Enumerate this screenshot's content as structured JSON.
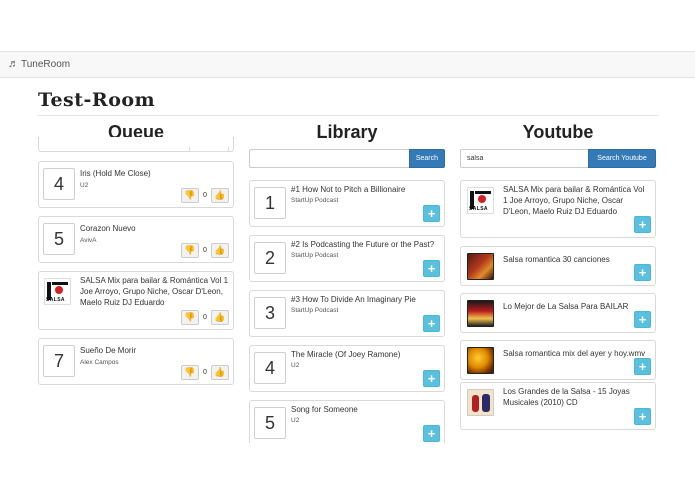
{
  "app": {
    "brand": "TuneRoom"
  },
  "room": {
    "title": "Test-Room"
  },
  "queue": {
    "title": "Queue",
    "items": [
      {
        "number": "4",
        "title": "Iris (Hold Me Close)",
        "artist": "U2",
        "votes": "0"
      },
      {
        "number": "5",
        "title": "Corazon Nuevo",
        "artist": "AvivA",
        "votes": "0"
      },
      {
        "title": "SALSA Mix para bailar & Romántica Vol 1 Joe Arroyo, Grupo Niche, Oscar D'Leon, Maelo Ruiz DJ Eduardo",
        "votes": "0"
      },
      {
        "number": "7",
        "title": "Sueño De Morir",
        "artist": "Alex Campos",
        "votes": "0"
      }
    ]
  },
  "library": {
    "title": "Library",
    "search": {
      "value": "",
      "button": "Search"
    },
    "items": [
      {
        "number": "1",
        "title": "#1 How Not to Pitch a Billionaire",
        "artist": "StartUp Podcast"
      },
      {
        "number": "2",
        "title": "#2 Is Podcasting the Future or the Past?",
        "artist": "StartUp Podcast"
      },
      {
        "number": "3",
        "title": "#3 How To Divide An Imaginary Pie",
        "artist": "StartUp Podcast"
      },
      {
        "number": "4",
        "title": "The Miracle (Of Joey Ramone)",
        "artist": "U2"
      },
      {
        "number": "5",
        "title": "Song for Someone",
        "artist": "U2"
      }
    ]
  },
  "youtube": {
    "title": "Youtube",
    "search": {
      "value": "salsa",
      "button": "Search Youtube"
    },
    "items": [
      {
        "title": "SALSA Mix para bailar & Romántica Vol 1 Joe Arroyo, Grupo Niche, Oscar D'Leon, Maelo Ruiz DJ Eduardo"
      },
      {
        "title": "Salsa romantica 30 canciones"
      },
      {
        "title": "Lo Mejor de La Salsa Para BAILAR"
      },
      {
        "title": "Salsa romantica mix del ayer y hoy.wmv"
      },
      {
        "title": "Los Grandes de la Salsa - 15 Joyas Musicales (2010) CD"
      }
    ]
  },
  "icons": {
    "thumbs_down": "thumbs-down-icon",
    "thumbs_up": "thumbs-up-icon",
    "add": "plus-icon",
    "note": "music-note-icon"
  },
  "colors": {
    "primary": "#337ab7",
    "info": "#5bc0de",
    "navbar": "#f8f8f8"
  }
}
